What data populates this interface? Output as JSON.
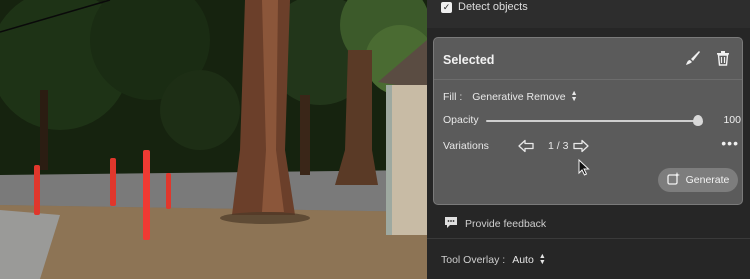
{
  "panel": {
    "detect_objects_label": "Detect objects",
    "detect_objects_checked": true,
    "selected_card": {
      "title": "Selected",
      "fill_label": "Fill :",
      "fill_value": "Generative Remove",
      "opacity_label": "Opacity",
      "opacity_value": "100",
      "opacity_fraction": 1.0,
      "variations_label": "Variations",
      "variations_count": "1 / 3",
      "more_label": "•••",
      "generate_label": "Generate"
    },
    "feedback_label": "Provide feedback",
    "tool_overlay_label": "Tool Overlay :",
    "tool_overlay_value": "Auto"
  },
  "icons": {
    "brush": "paintbrush-icon",
    "trash": "trash-icon",
    "prev": "arrow-left-icon",
    "next": "arrow-right-icon",
    "generate": "generate-sparkle-icon",
    "feedback": "chat-bubble-icon"
  },
  "colors": {
    "panel_bg": "#262626",
    "card_bg": "#5b5b5b",
    "generate_bg": "#7d7d7d"
  }
}
